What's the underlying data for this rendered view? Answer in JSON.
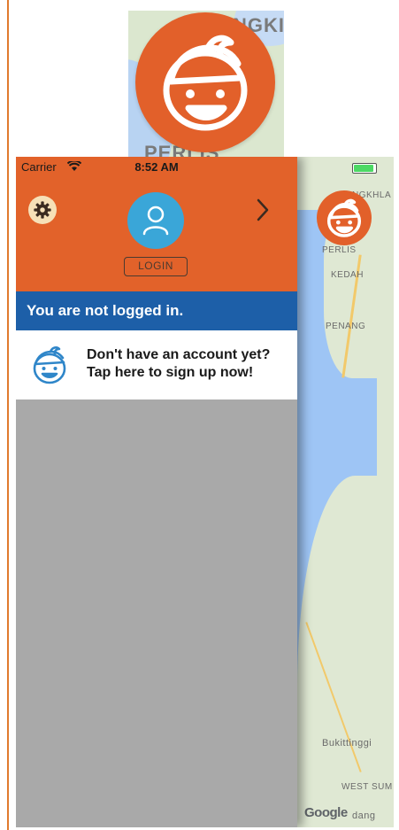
{
  "top_map": {
    "labels": [
      "NGKI",
      "PERLIS"
    ]
  },
  "status_bar": {
    "carrier": "Carrier",
    "time": "8:52 AM"
  },
  "drawer": {
    "login_label": "LOGIN",
    "notice": "You are not logged in.",
    "signup_line1": "Don't have an account yet?",
    "signup_line2": "Tap here to sign up now!"
  },
  "map": {
    "labels": {
      "top": "NGKHLA",
      "perlis": "PERLIS",
      "kedah": "KEDAH",
      "penang": "PENANG",
      "bukittinggi": "Bukittinggi",
      "west_sum": "WEST SUM",
      "dang": "dang"
    },
    "attribution": "Google"
  },
  "colors": {
    "accent_orange": "#e2622a",
    "notice_blue": "#1d5fa8",
    "avatar_blue": "#3aa6d8",
    "drawer_gray": "#a9a9a9"
  },
  "icons": [
    "gear-icon",
    "chevron-right-icon",
    "user-icon",
    "kid-face-icon",
    "wifi-icon",
    "battery-icon"
  ]
}
